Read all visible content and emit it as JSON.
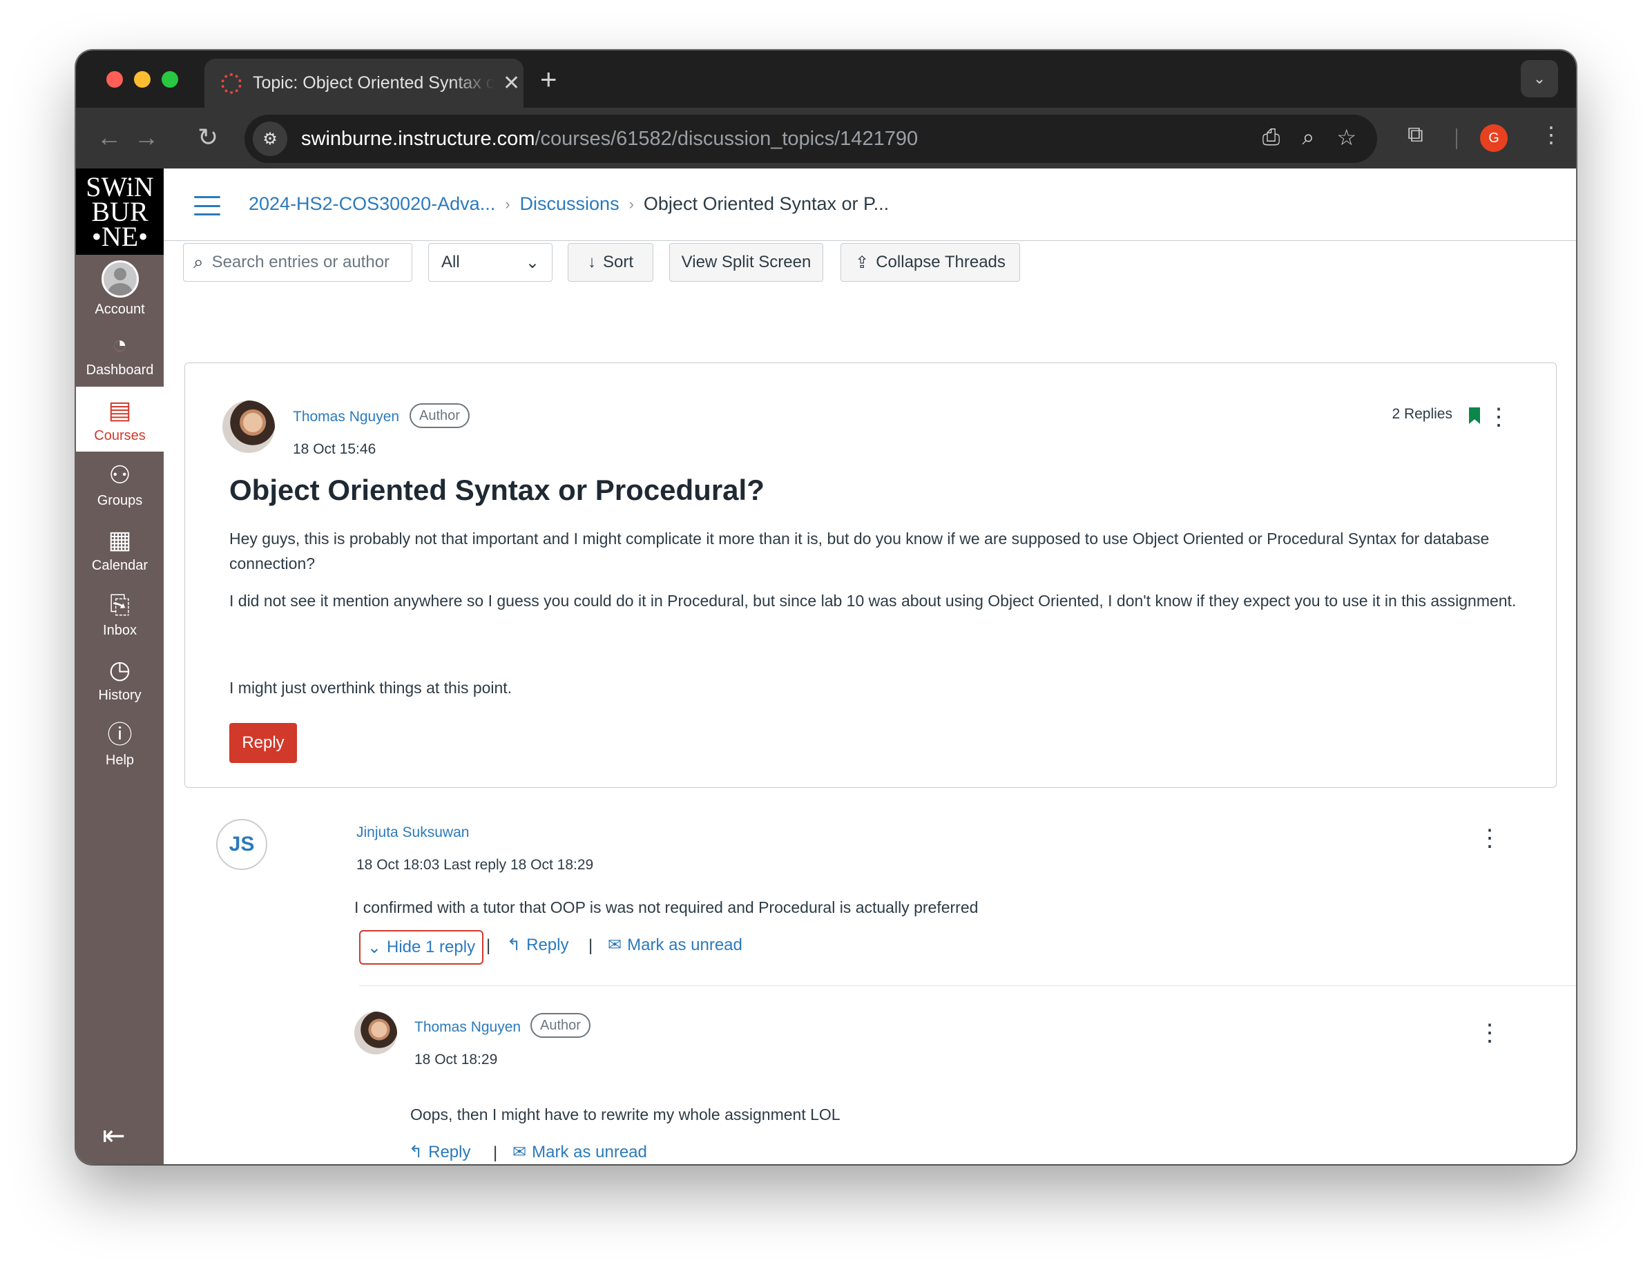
{
  "browser": {
    "tab_title": "Topic: Object Oriented Syntax or Procedural?",
    "url_host": "swinburne.instructure.com",
    "url_path": "/courses/61582/discussion_topics/1421790",
    "profile_initial": "G"
  },
  "global_nav": {
    "logo_lines": [
      "SWiN",
      "BUR",
      "•NE•"
    ],
    "items": [
      {
        "label": "Account",
        "icon": "account-icon"
      },
      {
        "label": "Dashboard",
        "icon": "dashboard-icon"
      },
      {
        "label": "Courses",
        "icon": "courses-icon",
        "active": true
      },
      {
        "label": "Groups",
        "icon": "groups-icon"
      },
      {
        "label": "Calendar",
        "icon": "calendar-icon"
      },
      {
        "label": "Inbox",
        "icon": "inbox-icon"
      },
      {
        "label": "History",
        "icon": "history-icon"
      },
      {
        "label": "Help",
        "icon": "help-icon"
      }
    ]
  },
  "breadcrumb": {
    "course": "2024-HS2-COS30020-Adva...",
    "section": "Discussions",
    "current": "Object Oriented Syntax or P..."
  },
  "toolbar": {
    "search_placeholder": "Search entries or author",
    "filter_value": "All",
    "sort_label": "Sort",
    "split_label": "View Split Screen",
    "collapse_label": "Collapse Threads"
  },
  "topic": {
    "author": "Thomas Nguyen",
    "author_badge": "Author",
    "date": "18 Oct 15:46",
    "replies": "2 Replies",
    "title": "Object Oriented Syntax or Procedural?",
    "paragraphs": [
      "Hey guys, this is probably not that important and I might complicate it more than it is, but do you know if we are supposed to use Object Oriented or Procedural Syntax for database connection?",
      "I did not see it mention anywhere so I guess you could do it in Procedural, but since lab 10 was about using Object Oriented, I don't know if they expect you to use it in this assignment.",
      "I might just overthink things at this point."
    ],
    "reply_label": "Reply"
  },
  "entries": [
    {
      "initials": "JS",
      "author": "Jinjuta Suksuwan",
      "meta": "18 Oct 18:03  Last reply 18 Oct 18:29",
      "text": "I confirmed with a tutor that OOP is was not required and Procedural is actually preferred",
      "hide_label": "Hide 1 reply",
      "reply_label": "Reply",
      "unread_label": "Mark as unread"
    },
    {
      "author": "Thomas Nguyen",
      "author_badge": "Author",
      "meta": "18 Oct 18:29",
      "text": "Oops, then I might have to rewrite my whole assignment LOL",
      "reply_label": "Reply",
      "unread_label": "Mark as unread"
    }
  ],
  "colors": {
    "canvas_nav": "#695b5a",
    "link_blue": "#2b7abc",
    "brand_red": "#d1392b",
    "bookmark_green": "#0b874b"
  }
}
